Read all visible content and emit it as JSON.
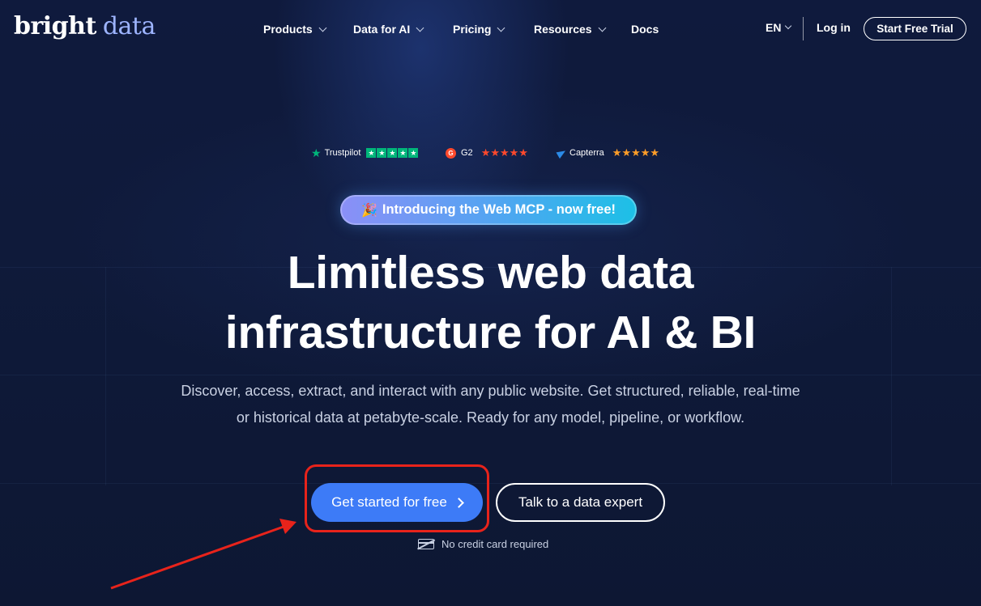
{
  "brand": {
    "word1": "bright",
    "word2": "data"
  },
  "nav": {
    "items": [
      {
        "label": "Products",
        "has_dropdown": true
      },
      {
        "label": "Data for AI",
        "has_dropdown": true
      },
      {
        "label": "Pricing",
        "has_dropdown": true
      },
      {
        "label": "Resources",
        "has_dropdown": true
      },
      {
        "label": "Docs",
        "has_dropdown": false
      }
    ],
    "language": "EN",
    "login_label": "Log in",
    "trial_label": "Start Free Trial"
  },
  "ratings": {
    "trustpilot": {
      "name": "Trustpilot",
      "icon": "trustpilot-star-icon",
      "stars": 5
    },
    "g2": {
      "name": "G2",
      "badge": "G",
      "icon": "g2-logo-icon",
      "stars": 4.5
    },
    "capterra": {
      "name": "Capterra",
      "icon": "capterra-logo-icon",
      "stars": 5
    }
  },
  "announcement": {
    "icon": "party-popper-icon",
    "label": "Introducing the Web MCP - now free!"
  },
  "hero": {
    "title_line1": "Limitless web data",
    "title_line2": "infrastructure for AI & BI",
    "subtitle_line1": "Discover, access, extract, and interact with any public website. Get structured, reliable, real-time",
    "subtitle_line2": "or historical data at petabyte-scale. Ready for any model, pipeline, or workflow."
  },
  "cta": {
    "primary_label": "Get started for free",
    "secondary_label": "Talk to a data expert",
    "note": "No credit card required"
  },
  "colors": {
    "background": "#0f1a3d",
    "primary_button": "#3d7bf7",
    "highlight": "#e8231b",
    "trustpilot": "#00b67a",
    "g2": "#ff492c",
    "capterra_stars": "#ff9d28",
    "logo_accent": "#9db4ff"
  }
}
